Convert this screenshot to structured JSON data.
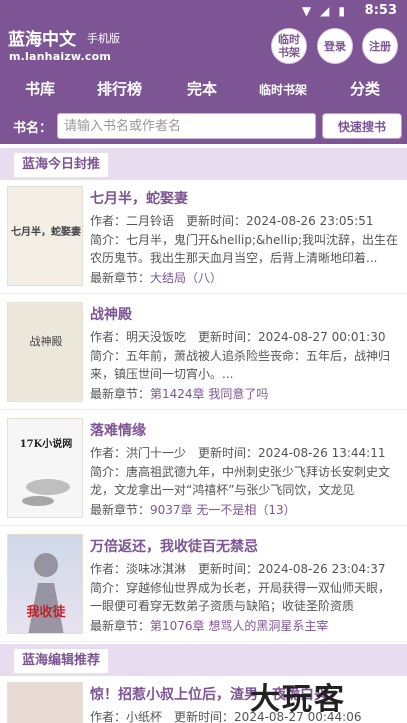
{
  "status": {
    "time": "8:53"
  },
  "header": {
    "title": "蓝海中文",
    "subtitle": "手机版",
    "url": "m.lanhaizw.com",
    "buttons": {
      "bookshelf": "临时书架",
      "login": "登录",
      "register": "注册"
    }
  },
  "nav": [
    "书库",
    "排行榜",
    "完本",
    "临时书架",
    "分类"
  ],
  "search": {
    "label": "书名：",
    "placeholder": "请输入书名或作者名",
    "button": "快速搜书"
  },
  "sections": {
    "recommended_today": "蓝海今日封推",
    "editor_pick": "蓝海编辑推荐"
  },
  "books": [
    {
      "title": "七月半，蛇娶妻",
      "author_label": "作者：",
      "author": "二月铃语",
      "update_label": "更新时间：",
      "updated": "2024-08-26 23:05:51",
      "intro": "简介：七月半，鬼门开&hellip;&hellip;我叫沈辞，出生在农历鬼节。我出生那天血月当空，后背上清晰地印着...",
      "latest_label": "最新章节：",
      "latest": "大结局（八）",
      "cover_text": "七月半，蛇娶妻"
    },
    {
      "title": "战神殿",
      "author_label": "作者：",
      "author": "明天没饭吃",
      "update_label": "更新时间：",
      "updated": "2024-08-27 00:01:30",
      "intro": "简介：五年前，萧战被人追杀险些丧命：五年后，战神归来，镇压世间一切宵小。...",
      "latest_label": "最新章节：",
      "latest": "第1424章 我同意了吗",
      "cover_text": "战神殿"
    },
    {
      "title": "落难情缘",
      "author_label": "作者：",
      "author": "洪门十一少",
      "update_label": "更新时间：",
      "updated": "2024-08-26 13:44:11",
      "intro": "简介：唐高祖武德九年，中州刺史张少飞拜访长安刺史文龙，文龙拿出一对“鸿禧杯”与张少飞同饮，文龙见",
      "latest_label": "最新章节：",
      "latest": "9037章 无一不是相（13）",
      "cover_text": "17K小说网"
    },
    {
      "title": "万倍返还，我收徒百无禁忌",
      "author_label": "作者：",
      "author": "淡味冰淇淋",
      "update_label": "更新时间：",
      "updated": "2024-08-26 23:04:37",
      "intro": "简介：穿越修仙世界成为长老，开局获得一双仙师天眼，一眼便可看穿无数弟子资质与缺陷；收徒圣阶资质",
      "latest_label": "最新章节：",
      "latest": "第1076章 想骂人的黑洞星系主宰",
      "cover_text": "我收徒"
    },
    {
      "title": "惊！招惹小叔上位后，渣男一夜跪白头",
      "author_label": "作者：",
      "author": "小纸杯",
      "update_label": "更新时间：",
      "updated": "2024-08-27 00:44:06"
    }
  ],
  "watermark": "大玩客",
  "colors": {
    "brand": "#7e5594",
    "section_bg": "#e8ddef"
  }
}
